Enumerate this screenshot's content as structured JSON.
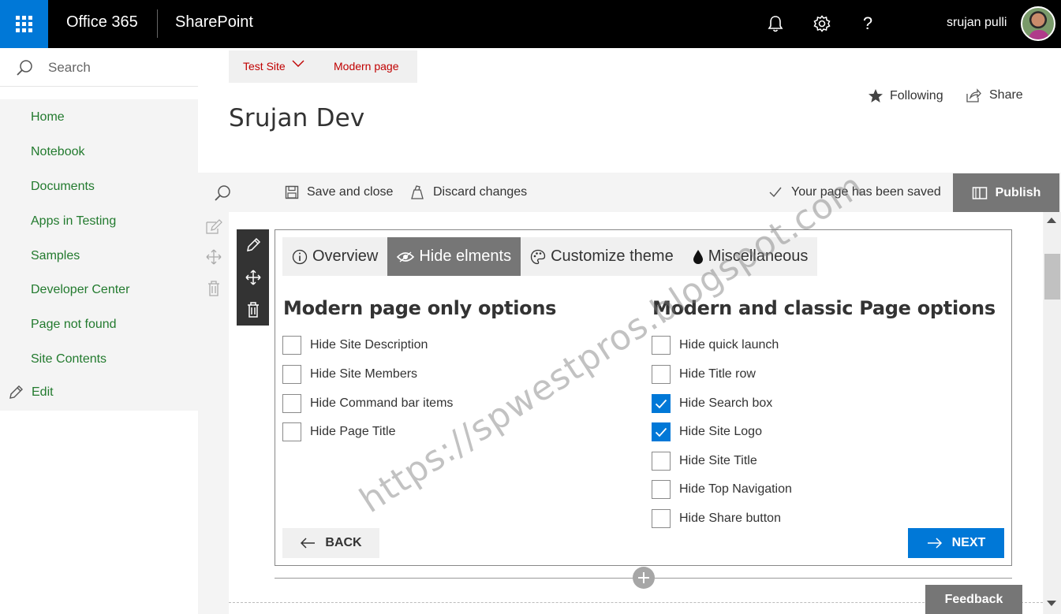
{
  "suite_bar": {
    "brand": "Office 365",
    "app": "SharePoint",
    "user_name": "srujan pulli",
    "help_symbol": "?"
  },
  "left_nav": {
    "search_placeholder": "Search",
    "items": [
      {
        "label": "Home"
      },
      {
        "label": "Notebook"
      },
      {
        "label": "Documents"
      },
      {
        "label": "Apps in Testing"
      },
      {
        "label": "Samples"
      },
      {
        "label": "Developer Center"
      },
      {
        "label": "Page not found"
      },
      {
        "label": "Site Contents"
      }
    ],
    "edit_label": "Edit",
    "link_color": "#227a2e"
  },
  "header": {
    "breadcrumb": [
      "Test Site",
      "Modern page"
    ],
    "site_title": "Srujan Dev",
    "following_label": "Following",
    "share_label": "Share"
  },
  "command_bar": {
    "save_close": "Save and close",
    "discard": "Discard changes",
    "saved_status": "Your page has been saved",
    "publish": "Publish"
  },
  "panel": {
    "tabs": [
      {
        "label": "Overview",
        "icon": "info-icon",
        "active": false
      },
      {
        "label": "Hide elments",
        "icon": "eye-icon",
        "active": true
      },
      {
        "label": "Customize theme",
        "icon": "palette-icon",
        "active": false
      },
      {
        "label": "Miscellaneous",
        "icon": "drop-icon",
        "active": false
      }
    ],
    "left_title": "Modern page only options",
    "right_title": "Modern and classic Page options",
    "left_options": [
      {
        "label": "Hide Site Description",
        "checked": false
      },
      {
        "label": "Hide Site Members",
        "checked": false
      },
      {
        "label": "Hide Command bar items",
        "checked": false
      },
      {
        "label": "Hide Page Title",
        "checked": false
      }
    ],
    "right_options": [
      {
        "label": "Hide quick launch",
        "checked": false
      },
      {
        "label": "Hide Title row",
        "checked": false
      },
      {
        "label": "Hide Search box",
        "checked": true
      },
      {
        "label": "Hide Site Logo",
        "checked": true
      },
      {
        "label": "Hide Site Title",
        "checked": false
      },
      {
        "label": "Hide Top Navigation",
        "checked": false
      },
      {
        "label": "Hide Share button",
        "checked": false
      }
    ],
    "back_label": "BACK",
    "next_label": "NEXT"
  },
  "feedback_label": "Feedback",
  "watermark": "https://spwestpros.blogspot.com",
  "colors": {
    "accent": "#0078d7",
    "breadcrumb_text": "#c00000",
    "active_tab": "#767676"
  }
}
